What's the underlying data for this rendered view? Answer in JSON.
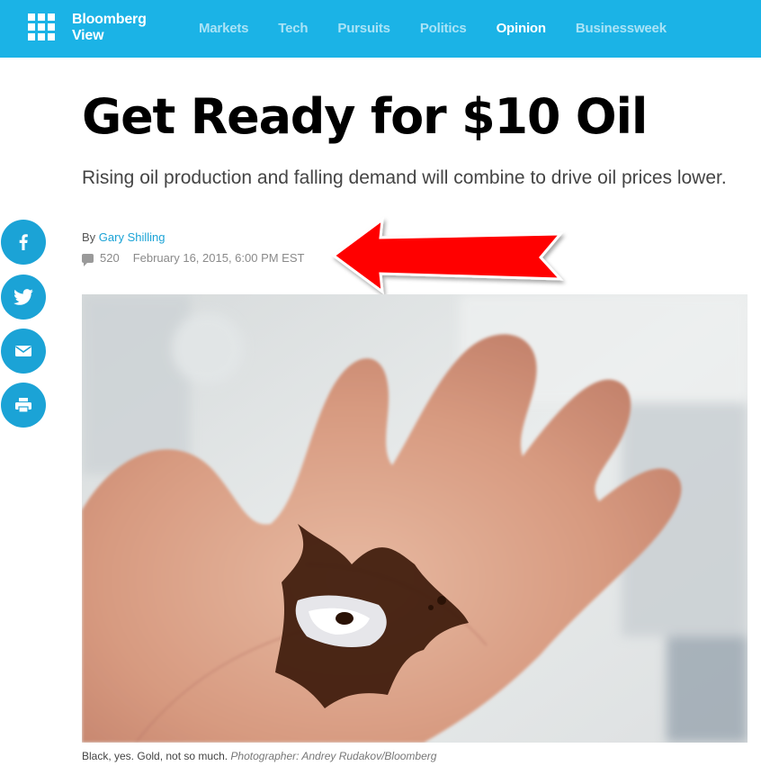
{
  "header": {
    "brand_line1": "Bloomberg",
    "brand_line2": "View",
    "nav": [
      {
        "label": "Markets"
      },
      {
        "label": "Tech"
      },
      {
        "label": "Pursuits"
      },
      {
        "label": "Politics"
      },
      {
        "label": "Opinion",
        "active": true
      },
      {
        "label": "Businessweek"
      }
    ],
    "colors": {
      "bar": "#1bb3e6",
      "nav_inactive": "#a9e3f6",
      "nav_active": "#ffffff"
    }
  },
  "article": {
    "title": "Get Ready for $10 Oil",
    "subtitle": "Rising oil production and falling demand will combine to drive oil prices lower.",
    "byline_prefix": "By ",
    "author": "Gary Shilling",
    "comment_count": "520",
    "date": "February 16, 2015, 6:00 PM EST",
    "caption_text": "Black, yes. Gold, not so much. ",
    "caption_credit": "Photographer: Andrey Rudakov/Bloomberg"
  },
  "share": {
    "icons": [
      "facebook-icon",
      "twitter-icon",
      "email-icon",
      "print-icon"
    ],
    "color": "#1ba3d6"
  },
  "annotation": {
    "arrow_color": "#ff0000"
  }
}
